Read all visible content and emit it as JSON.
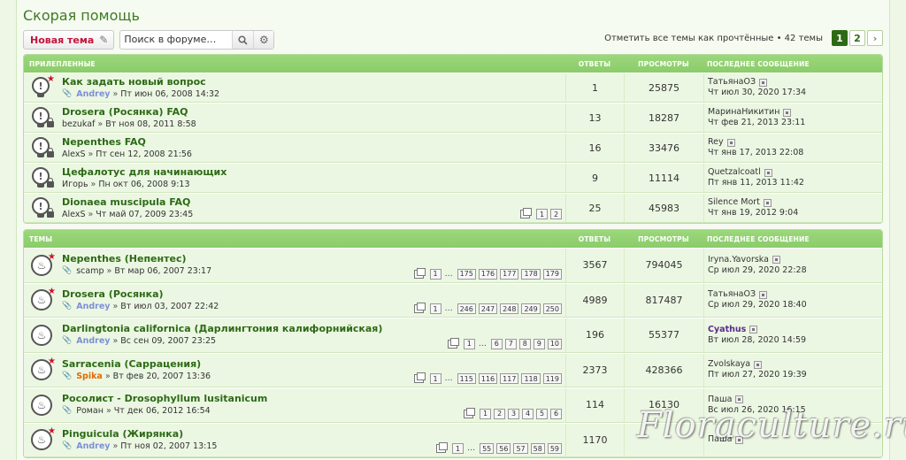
{
  "page_title": "Скорая помощь",
  "toolbar": {
    "new_topic_label": "Новая тема",
    "search_placeholder": "Поиск в форуме…",
    "mark_read_text": "Отметить все темы как прочтённые • 42 темы",
    "pages": [
      "1",
      "2"
    ],
    "active_page": "1",
    "next_label": "›"
  },
  "sticky": {
    "heading": "Прилепленные",
    "col_replies": "Ответы",
    "col_views": "Просмотры",
    "col_last": "Последнее сообщение",
    "rows": [
      {
        "title": "Как задать новый вопрос",
        "clip": true,
        "author": "Andrey",
        "author_style": "blue",
        "date": "Пт июн 06, 2008 14:32",
        "replies": "1",
        "views": "25875",
        "last_user": "ТатьянаОЗ",
        "last_date": "Чт июл 30, 2020 17:34",
        "icon": "sticky-new",
        "pages": []
      },
      {
        "title": "Drosera (Росянка) FAQ",
        "clip": false,
        "author": "bezukaf",
        "author_style": "",
        "date": "Вт ноя 08, 2011 8:58",
        "replies": "13",
        "views": "18287",
        "last_user": "МаринаНикитин",
        "last_date": "Чт фев 21, 2013 23:11",
        "icon": "sticky-locked",
        "pages": []
      },
      {
        "title": "Nepenthes FAQ",
        "clip": false,
        "author": "AlexS",
        "author_style": "",
        "date": "Пт сен 12, 2008 21:56",
        "replies": "16",
        "views": "33476",
        "last_user": "Rey",
        "last_date": "Чт янв 17, 2013 22:08",
        "icon": "sticky-locked",
        "pages": []
      },
      {
        "title": "Цефалотус для начинающих",
        "clip": false,
        "author": "Игорь",
        "author_style": "",
        "date": "Пн окт 06, 2008 9:13",
        "replies": "9",
        "views": "11114",
        "last_user": "Quetzalcoatl",
        "last_date": "Пт янв 11, 2013 11:42",
        "icon": "sticky-locked",
        "pages": []
      },
      {
        "title": "Dionaea muscipula FAQ",
        "clip": false,
        "author": "AlexS",
        "author_style": "",
        "date": "Чт май 07, 2009 23:45",
        "replies": "25",
        "views": "45983",
        "last_user": "Silence Mort",
        "last_date": "Чт янв 19, 2012 9:04",
        "icon": "sticky-locked",
        "pages": [
          "1",
          "2"
        ]
      }
    ]
  },
  "topics": {
    "heading": "Темы",
    "col_replies": "Ответы",
    "col_views": "Просмотры",
    "col_last": "Последнее сообщение",
    "rows": [
      {
        "title": "Nepenthes (Непентес)",
        "clip": true,
        "author": "scamp",
        "author_style": "",
        "date": "Вт мар 06, 2007 23:17",
        "replies": "3567",
        "views": "794045",
        "last_user": "Iryna.Yavorska",
        "last_user_bold": false,
        "last_date": "Ср июл 29, 2020 22:28",
        "hot": true,
        "pages": [
          "1",
          "…",
          "175",
          "176",
          "177",
          "178",
          "179"
        ]
      },
      {
        "title": "Drosera (Росянка)",
        "clip": true,
        "author": "Andrey",
        "author_style": "blue",
        "date": "Вт июл 03, 2007 22:42",
        "replies": "4989",
        "views": "817487",
        "last_user": "ТатьянаОЗ",
        "last_user_bold": false,
        "last_date": "Ср июл 29, 2020 18:40",
        "hot": true,
        "pages": [
          "1",
          "…",
          "246",
          "247",
          "248",
          "249",
          "250"
        ]
      },
      {
        "title": "Darlingtonia californica (Дарлингтония калифорнийская)",
        "clip": true,
        "author": "Andrey",
        "author_style": "blue",
        "date": "Вс сен 09, 2007 23:25",
        "replies": "196",
        "views": "55377",
        "last_user": "Cyathus",
        "last_user_bold": true,
        "last_date": "Вт июл 28, 2020 14:59",
        "hot": false,
        "pages": [
          "1",
          "…",
          "6",
          "7",
          "8",
          "9",
          "10"
        ]
      },
      {
        "title": "Sarracenia (Саррацения)",
        "clip": true,
        "author": "Spika",
        "author_style": "orange",
        "date": "Вт фев 20, 2007 13:36",
        "replies": "2373",
        "views": "428366",
        "last_user": "Zvolskaya",
        "last_user_bold": false,
        "last_date": "Пт июл 27, 2020 19:39",
        "hot": true,
        "pages": [
          "1",
          "…",
          "115",
          "116",
          "117",
          "118",
          "119"
        ]
      },
      {
        "title": "Росолист - Drosophyllum lusitanicum",
        "clip": true,
        "author": "Роман",
        "author_style": "",
        "date": "Чт дек 06, 2012 16:54",
        "replies": "114",
        "views": "16130",
        "last_user": "Паша",
        "last_user_bold": false,
        "last_date": "Вс июл 26, 2020 16:15",
        "hot": false,
        "pages": [
          "1",
          "2",
          "3",
          "4",
          "5",
          "6"
        ]
      },
      {
        "title": "Pinguicula (Жирянка)",
        "clip": true,
        "author": "Andrey",
        "author_style": "blue",
        "date": "Пт ноя 02, 2007 13:15",
        "replies": "1170",
        "views": "",
        "last_user": "Паша",
        "last_user_bold": false,
        "last_date": "",
        "hot": true,
        "pages": [
          "1",
          "…",
          "55",
          "56",
          "57",
          "58",
          "59"
        ]
      }
    ]
  },
  "watermark": "Floraculture.ru",
  "colors": {
    "accent": "#2d6a16",
    "header_green": "#93d272",
    "row_bg": "#ecf7e3",
    "new_topic_text": "#c2153a"
  }
}
